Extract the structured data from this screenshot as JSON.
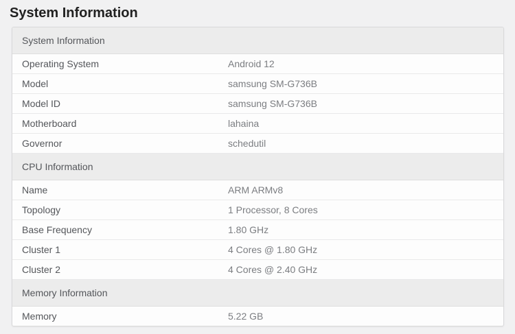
{
  "page": {
    "title": "System Information"
  },
  "card": {
    "sections": [
      {
        "header": "System Information",
        "rows": [
          {
            "label": "Operating System",
            "value": "Android 12"
          },
          {
            "label": "Model",
            "value": "samsung SM-G736B"
          },
          {
            "label": "Model ID",
            "value": "samsung SM-G736B"
          },
          {
            "label": "Motherboard",
            "value": "lahaina"
          },
          {
            "label": "Governor",
            "value": "schedutil"
          }
        ]
      },
      {
        "header": "CPU Information",
        "rows": [
          {
            "label": "Name",
            "value": "ARM ARMv8"
          },
          {
            "label": "Topology",
            "value": "1 Processor, 8 Cores"
          },
          {
            "label": "Base Frequency",
            "value": "1.80 GHz"
          },
          {
            "label": "Cluster 1",
            "value": "4 Cores @ 1.80 GHz"
          },
          {
            "label": "Cluster 2",
            "value": "4 Cores @ 2.40 GHz"
          }
        ]
      },
      {
        "header": "Memory Information",
        "rows": [
          {
            "label": "Memory",
            "value": "5.22 GB"
          }
        ]
      }
    ]
  },
  "colors": {
    "page_bg": "#f1f1f2",
    "card_bg": "#fdfdfd",
    "section_header_bg": "#ececec",
    "card_border": "#d9d9da",
    "row_divider": "#e9e9ea",
    "title_text": "#212121",
    "label_text": "#54565a",
    "value_text": "#7b7d81"
  }
}
